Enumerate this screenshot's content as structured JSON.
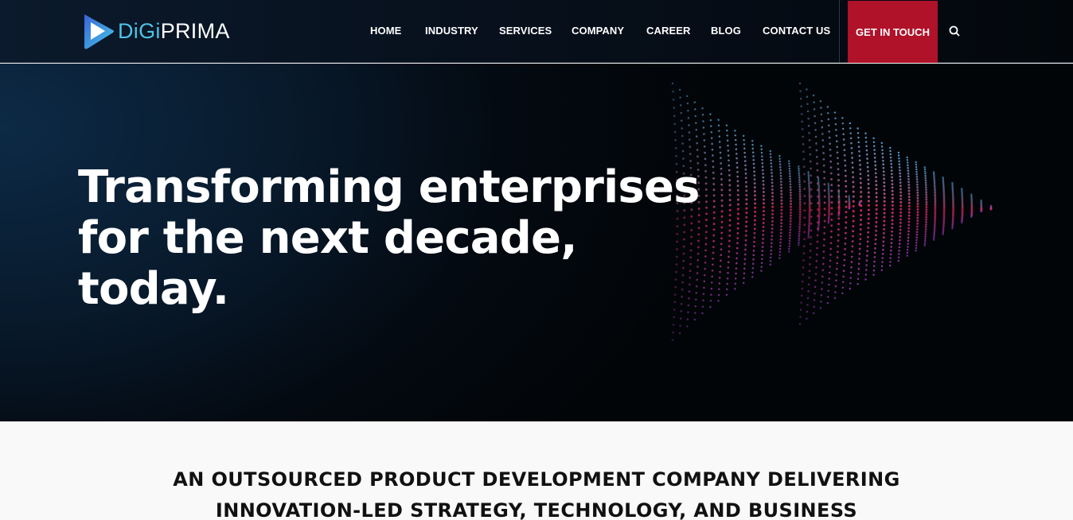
{
  "brand": {
    "logo_prefix": "DiGi",
    "logo_suffix": "PRIMA",
    "colors": {
      "accent_red": "#b0122a",
      "logo_cyan": "#4fc3e6",
      "logo_blue": "#2f6fe0"
    }
  },
  "nav": {
    "items": [
      "HOME",
      "INDUSTRY",
      "SERVICES",
      "COMPANY",
      "CAREER",
      "BLOG",
      "CONTACT US"
    ],
    "cta_label": "GET IN TOUCH",
    "search_icon": "search-icon"
  },
  "hero": {
    "title_line1": "Transforming enterprises",
    "title_line2": "for the next decade, today."
  },
  "intro": {
    "line1": "AN OUTSOURCED PRODUCT DEVELOPMENT COMPANY DELIVERING",
    "line2": "INNOVATION-LED STRATEGY, TECHNOLOGY, AND BUSINESS"
  }
}
